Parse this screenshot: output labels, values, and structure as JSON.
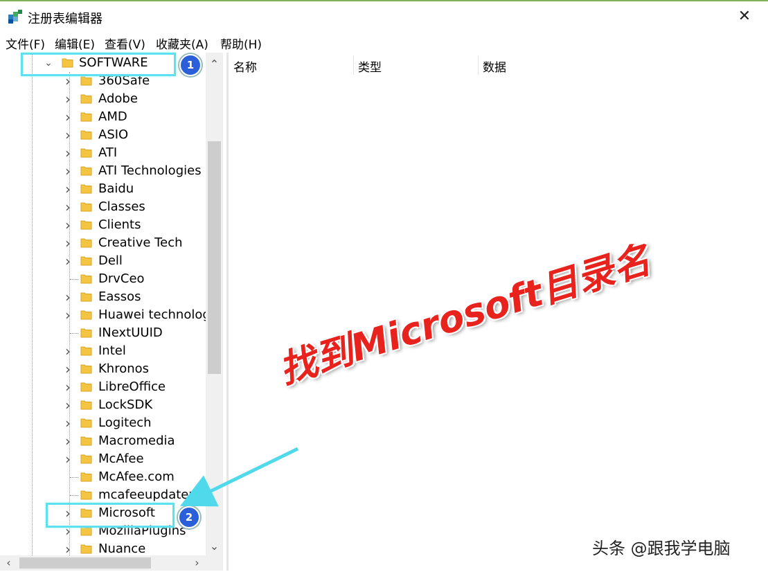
{
  "window": {
    "title": "注册表编辑器",
    "close_glyph": "✕"
  },
  "menu": [
    "文件(F)",
    "编辑(E)",
    "查看(V)",
    "收藏夹(A)",
    "帮助(H)"
  ],
  "tree": {
    "expanded_node": "SOFTWARE",
    "children": [
      {
        "label": "360Safe",
        "expandable": true
      },
      {
        "label": "Adobe",
        "expandable": true
      },
      {
        "label": "AMD",
        "expandable": true
      },
      {
        "label": "ASIO",
        "expandable": true
      },
      {
        "label": "ATI",
        "expandable": true
      },
      {
        "label": "ATI Technologies",
        "expandable": true
      },
      {
        "label": "Baidu",
        "expandable": true
      },
      {
        "label": "Classes",
        "expandable": true
      },
      {
        "label": "Clients",
        "expandable": true
      },
      {
        "label": "Creative Tech",
        "expandable": true
      },
      {
        "label": "Dell",
        "expandable": true
      },
      {
        "label": "DrvCeo",
        "expandable": false
      },
      {
        "label": "Eassos",
        "expandable": true
      },
      {
        "label": "Huawei technolog",
        "expandable": true
      },
      {
        "label": "INextUUID",
        "expandable": false
      },
      {
        "label": "Intel",
        "expandable": true
      },
      {
        "label": "Khronos",
        "expandable": true
      },
      {
        "label": "LibreOffice",
        "expandable": true
      },
      {
        "label": "LockSDK",
        "expandable": true
      },
      {
        "label": "Logitech",
        "expandable": true
      },
      {
        "label": "Macromedia",
        "expandable": true
      },
      {
        "label": "McAfee",
        "expandable": true
      },
      {
        "label": "McAfee.com",
        "expandable": false
      },
      {
        "label": "mcafeeupdater",
        "expandable": false
      },
      {
        "label": "Microsoft",
        "expandable": true
      },
      {
        "label": "MozillaPlugins",
        "expandable": true
      },
      {
        "label": "Nuance",
        "expandable": true
      }
    ]
  },
  "columns": [
    "名称",
    "类型",
    "数据"
  ],
  "annotations": {
    "badge1": "1",
    "badge2": "2",
    "callout": "找到Microsoft目录名",
    "watermark": "头条 @跟我学电脑"
  },
  "colors": {
    "highlight": "#5fe0f0",
    "badge": "#2b5fd9",
    "callout": "#e8231e"
  }
}
